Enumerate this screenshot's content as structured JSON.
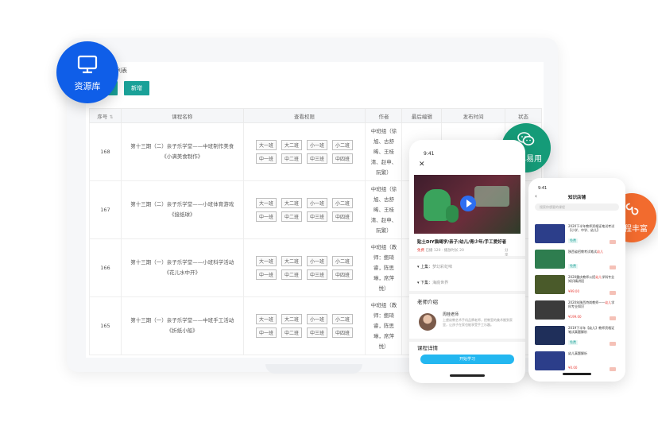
{
  "badges": {
    "resource": "资源库",
    "simple": "简单易用",
    "course": "课程丰富"
  },
  "desktop": {
    "page_title": "列表",
    "buttons": {
      "first": "",
      "add": "新增"
    },
    "columns": [
      "序号",
      "课程名称",
      "查看权限",
      "作者",
      "最后编辑",
      "发布时间",
      "状态"
    ],
    "rows": [
      {
        "id": "168",
        "name_line1": "第十三期（二）亲子乐学堂——中班制作美食",
        "name_line2": "《小满美食制作》",
        "tags": [
          "大一班",
          "大二班",
          "小一班",
          "小二班",
          "中一班",
          "中二班",
          "中三班",
          "中四班"
        ],
        "author": [
          "中班组（徐",
          "旭、古舒",
          "晞、王桂",
          "清、赵申、",
          "阮繁）"
        ]
      },
      {
        "id": "167",
        "name_line1": "第十三期（二）亲子乐学堂——小班体育游戏",
        "name_line2": "《接纸球》",
        "tags": [
          "大一班",
          "大二班",
          "小一班",
          "小二班",
          "中一班",
          "中二班",
          "中三班",
          "中四班"
        ],
        "author": [
          "中班组（徐",
          "旭、古舒",
          "晞、王桂",
          "清、赵申、",
          "阮繁）"
        ]
      },
      {
        "id": "166",
        "name_line1": "第十三期（一）亲子乐学堂——小班科学活动",
        "name_line2": "《花儿水中开》",
        "tags": [
          "大一班",
          "大二班",
          "小一班",
          "小二班",
          "中一班",
          "中二班",
          "中三班",
          "中四班"
        ],
        "author": [
          "中班组（教",
          "师：鲍琦",
          "睿，陈思",
          "琳，席萍",
          "悦）"
        ]
      },
      {
        "id": "165",
        "name_line1": "第十三期（一）亲子乐学堂——中班手工活动",
        "name_line2": "《折纸小船》",
        "tags": [
          "大一班",
          "大二班",
          "小一班",
          "小二班",
          "中一班",
          "中二班",
          "中三班",
          "中四班"
        ],
        "author": [
          "中班组（教",
          "师：鲍琦",
          "睿，陈思",
          "琳，席萍",
          "悦）"
        ]
      }
    ]
  },
  "phone1": {
    "time": "9:41",
    "close": "✕",
    "title": "贴土DIY猫绳学/亲子/幼儿/青少年/手工爱好者",
    "meta_free": "免费",
    "meta_stats": "已播 120 · 播放时长 20",
    "meta_share": "分享",
    "prev": "上集：",
    "prev_title": "梦幻彩虹味",
    "next": "下集：",
    "next_title": "海底世界",
    "teacher_section": "老师介绍",
    "teacher_name": "周桂老师",
    "teacher_desc": "上虞幼教艺术手机品牌老师，把教室的美术搬到家里，让孩子在家也能享受手工乐趣。",
    "detail_section": "课程详情",
    "learn_button": "开始学习"
  },
  "phone2": {
    "time": "9:41",
    "title": "知识店铺",
    "search_placeholder": "搜索你想要的课程",
    "items": [
      {
        "text": "2020下半年教师资格证笔试考试【小学、中学、幼儿】",
        "tag": "免费",
        "kind": "free",
        "color": "#2c3e8a"
      },
      {
        "text": "陕西省招教考试笔试",
        "hl": "幼儿",
        "tag": "免费",
        "kind": "free",
        "color": "#2e7d4f"
      },
      {
        "text": "2020重庆教师公招",
        "hl": "幼儿",
        "text2": "学科专业知识精讲班",
        "tag": "¥99.00",
        "kind": "price",
        "color": "#4a5a2a"
      },
      {
        "text": "2020年陕西特岗教师——",
        "hl": "幼儿",
        "text2": "学科专业知识",
        "tag": "¥199.00",
        "kind": "price",
        "color": "#3b3b3b"
      },
      {
        "text": "2019下半年【幼儿】教师资格证笔试真题解析",
        "tag": "免费",
        "kind": "free",
        "color": "#1f2f5a"
      },
      {
        "text": "幼儿真题解析",
        "tag": "¥0.00",
        "kind": "price",
        "color": "#2c3e8a"
      }
    ]
  }
}
